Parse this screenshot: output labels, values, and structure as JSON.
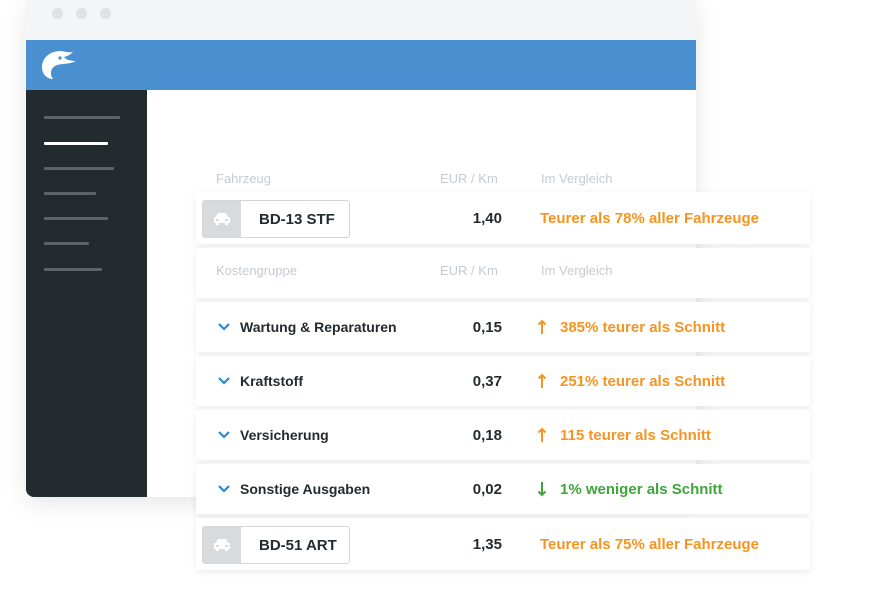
{
  "window": {
    "sidebar": {
      "menu_items": 7,
      "active_index": 1
    }
  },
  "table": {
    "vehicle_header": {
      "col1": "Fahrzeug",
      "col2": "EUR / Km",
      "col3": "Im Vergleich"
    },
    "vehicles": [
      {
        "plate": "BD-13 STF",
        "eur_km": "1,40",
        "comparison": "Teurer als 78% aller Fahrzeuge"
      },
      {
        "plate": "BD-51 ART",
        "eur_km": "1,35",
        "comparison": "Teurer als 75% aller Fahrzeuge"
      }
    ],
    "cost_header": {
      "col1": "Kostengruppe",
      "col2": "EUR / Km",
      "col3": "Im Vergleich"
    },
    "cost_groups": [
      {
        "name": "Wartung & Reparaturen",
        "eur_km": "0,15",
        "direction": "up",
        "comparison": "385% teurer als Schnitt"
      },
      {
        "name": "Kraftstoff",
        "eur_km": "0,37",
        "direction": "up",
        "comparison": "251% teurer als Schnitt"
      },
      {
        "name": "Versicherung",
        "eur_km": "0,18",
        "direction": "up",
        "comparison": "115 teurer als Schnitt"
      },
      {
        "name": "Sonstige Ausgaben",
        "eur_km": "0,02",
        "direction": "down",
        "comparison": "1% weniger als Schnitt"
      }
    ]
  },
  "colors": {
    "brand": "#4a90d0",
    "sidebar": "#232b2f",
    "increase": "#f59420",
    "decrease": "#3fa53a"
  },
  "icons": [
    "logo-icon",
    "car-icon",
    "chevron-down-icon",
    "arrow-up-icon",
    "arrow-down-icon"
  ]
}
